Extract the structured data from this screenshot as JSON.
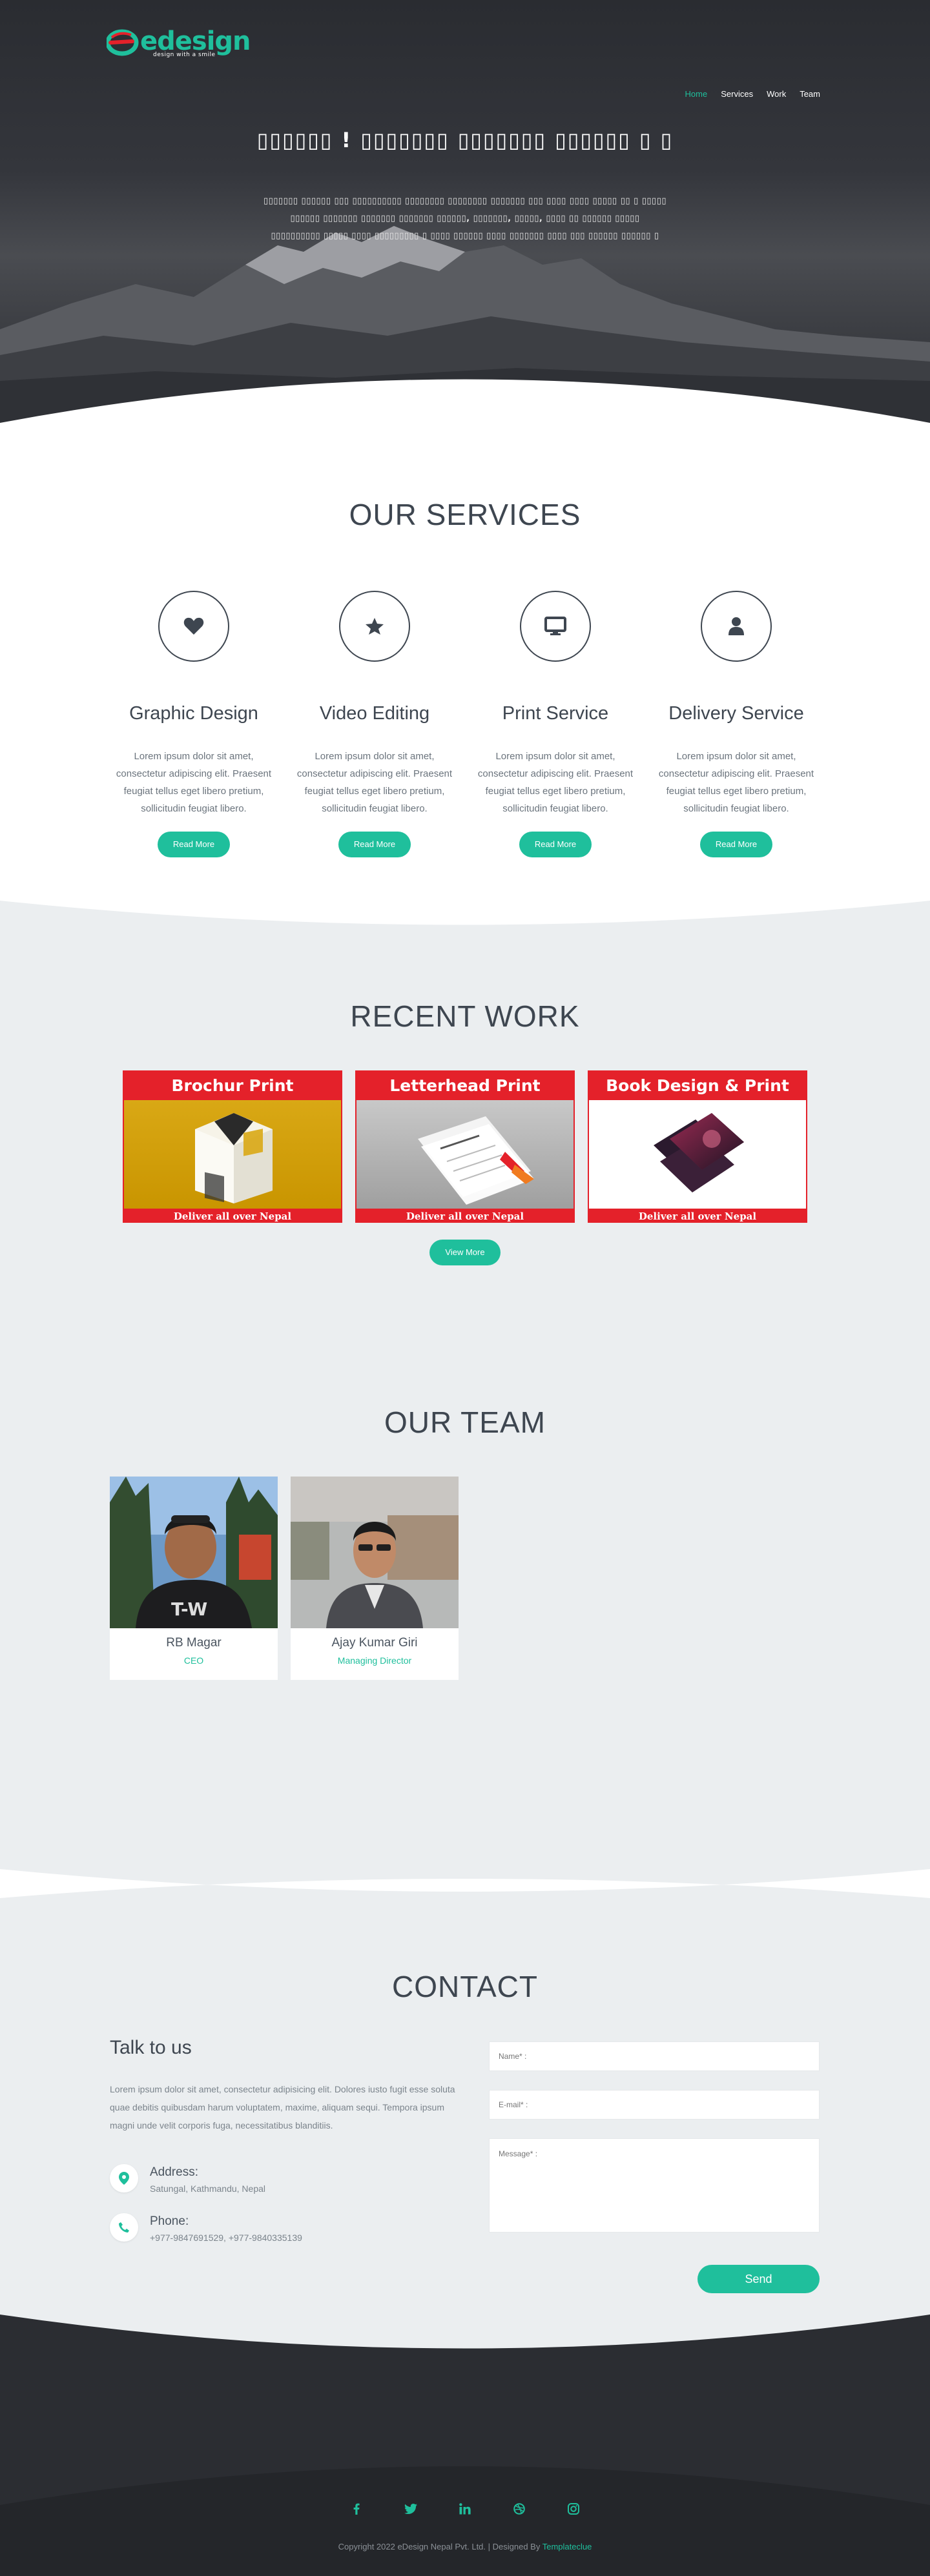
{
  "brand": {
    "name": "edesign",
    "tagline": "design with a smile",
    "accent": "#1fbf9c"
  },
  "nav": {
    "items": [
      {
        "label": "Home",
        "active": true
      },
      {
        "label": "Services",
        "active": false
      },
      {
        "label": "Work",
        "active": false
      },
      {
        "label": "Team",
        "active": false
      }
    ]
  },
  "hero": {
    "title": "▯▯▯▯▯▯ ! ▯▯▯▯▯▯▯ ▯▯▯▯▯▯▯ ▯▯▯▯▯▯ ▯ ▯",
    "line1": "▯▯▯▯▯▯▯ ▯▯▯▯▯▯ ▯▯▯ ▯▯▯▯▯▯▯▯▯▯ ▯▯▯▯▯▯▯▯ ▯▯▯▯▯▯▯▯ ▯▯▯▯▯▯▯ ▯▯▯ ▯▯▯▯ ▯▯▯▯ ▯▯▯▯▯ ▯▯ ▯ ▯▯▯▯▯",
    "line2": "▯▯▯▯▯▯ ▯▯▯▯▯▯▯ ▯▯▯▯▯▯▯ ▯▯▯▯▯▯▯ ▯▯▯▯▯▯, ▯▯▯▯▯▯▯, ▯▯▯▯▯, ▯▯▯▯ ▯▯ ▯▯▯▯▯▯ ▯▯▯▯▯",
    "line3": "▯▯▯▯▯▯▯▯▯▯ ▯▯▯▯▯ ▯▯▯▯ ▯▯▯▯▯▯▯▯▯ ▯ ▯▯▯▯ ▯▯▯▯▯▯ ▯▯▯▯ ▯▯▯▯▯▯▯ ▯▯▯▯ ▯▯▯ ▯▯▯▯▯▯ ▯▯▯▯▯▯ ▯"
  },
  "services": {
    "title": "OUR SERVICES",
    "items": [
      {
        "name": "Graphic Design",
        "icon": "heart-icon",
        "text": "Lorem ipsum dolor sit amet, consectetur adipiscing elit. Praesent feugiat tellus eget libero pretium, sollicitudin feugiat libero.",
        "button": "Read More"
      },
      {
        "name": "Video Editing",
        "icon": "star-icon",
        "text": "Lorem ipsum dolor sit amet, consectetur adipiscing elit. Praesent feugiat tellus eget libero pretium, sollicitudin feugiat libero.",
        "button": "Read More"
      },
      {
        "name": "Print Service",
        "icon": "monitor-icon",
        "text": "Lorem ipsum dolor sit amet, consectetur adipiscing elit. Praesent feugiat tellus eget libero pretium, sollicitudin feugiat libero.",
        "button": "Read More"
      },
      {
        "name": "Delivery Service",
        "icon": "user-icon",
        "text": "Lorem ipsum dolor sit amet, consectetur adipiscing elit. Praesent feugiat tellus eget libero pretium, sollicitudin feugiat libero.",
        "button": "Read More"
      }
    ]
  },
  "work": {
    "title": "RECENT WORK",
    "items": [
      {
        "title": "Brochur Print",
        "footer": "Deliver all over Nepal"
      },
      {
        "title": "Letterhead Print",
        "footer": "Deliver all over Nepal"
      },
      {
        "title": "Book Design & Print",
        "footer": "Deliver all over Nepal"
      }
    ],
    "button": "View More"
  },
  "team": {
    "title": "OUR TEAM",
    "members": [
      {
        "name": "RB Magar",
        "role": "CEO"
      },
      {
        "name": "Ajay Kumar Giri",
        "role": "Managing Director"
      }
    ]
  },
  "contact": {
    "title": "CONTACT",
    "talk_title": "Talk to us",
    "talk_text": "Lorem ipsum dolor sit amet, consectetur adipisicing elit. Dolores iusto fugit esse soluta quae debitis quibusdam harum voluptatem, maxime, aliquam sequi. Tempora ipsum magni unde velit corporis fuga, necessitatibus blanditiis.",
    "address_label": "Address:",
    "address_value": "Satungal, Kathmandu, Nepal",
    "phone_label": "Phone:",
    "phone_value": "+977-9847691529, +977-9840335139",
    "name_placeholder": "Name* :",
    "email_placeholder": "E-mail* :",
    "message_placeholder": "Message* :",
    "send": "Send"
  },
  "footer": {
    "socials": [
      "facebook-icon",
      "twitter-icon",
      "linkedin-icon",
      "dribbble-icon",
      "instagram-icon"
    ],
    "copyright": "Copyright 2022 eDesign Nepal Pvt. Ltd. | Designed By ",
    "designer": "Templateclue"
  }
}
